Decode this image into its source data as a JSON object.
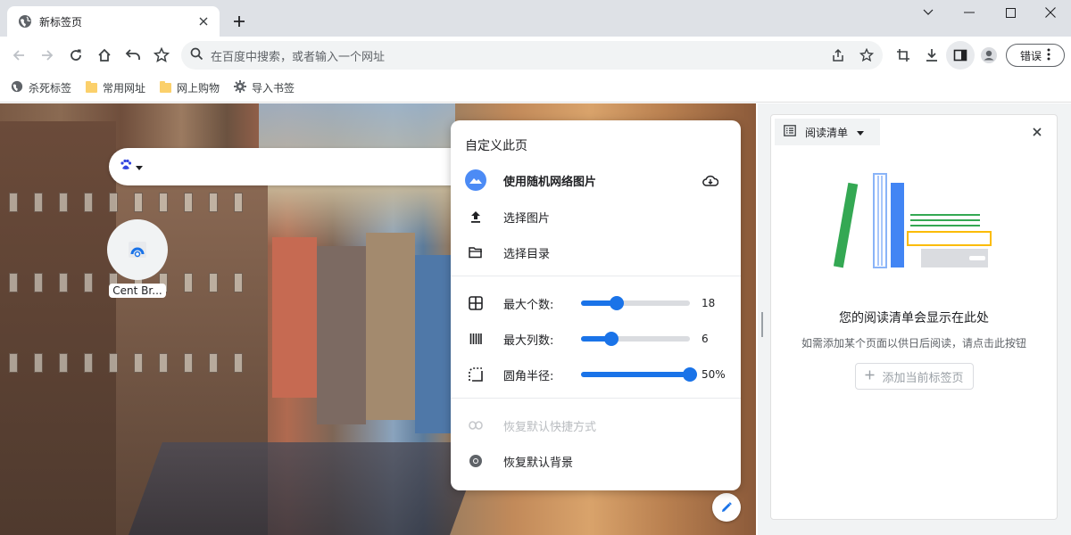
{
  "tab": {
    "title": "新标签页"
  },
  "window": {
    "minimize": "minimize",
    "maximize": "maximize",
    "close": "close"
  },
  "omnibox": {
    "placeholder": "在百度中搜索，或者输入一个网址"
  },
  "toolbar": {
    "error_button": "错误"
  },
  "bookmarks": [
    {
      "label": "杀死标签",
      "icon": "globe-icon"
    },
    {
      "label": "常用网址",
      "icon": "folder-icon"
    },
    {
      "label": "网上购物",
      "icon": "folder-icon"
    },
    {
      "label": "导入书签",
      "icon": "gear-icon"
    }
  ],
  "ntp": {
    "shortcut_label": "Cent Br...",
    "search_engine_icon": "baidu-paw-icon"
  },
  "customize": {
    "title": "自定义此页",
    "random_image": "使用随机网络图片",
    "choose_image": "选择图片",
    "choose_folder": "选择目录",
    "max_count_label": "最大个数:",
    "max_count_value": "18",
    "max_count_fraction": 0.33,
    "max_columns_label": "最大列数:",
    "max_columns_value": "6",
    "max_columns_fraction": 0.28,
    "radius_label": "圆角半径:",
    "radius_value": "50%",
    "radius_fraction": 1.0,
    "restore_shortcuts": "恢复默认快捷方式",
    "restore_background": "恢复默认背景"
  },
  "side_panel": {
    "selector_label": "阅读清单",
    "heading": "您的阅读清单会显示在此处",
    "description": "如需添加某个页面以供日后阅读，请点击此按钮",
    "add_button": "添加当前标签页"
  },
  "colors": {
    "accent": "#1a73e8",
    "tabstrip": "#dee1e6",
    "omnibox": "#f1f3f4"
  }
}
